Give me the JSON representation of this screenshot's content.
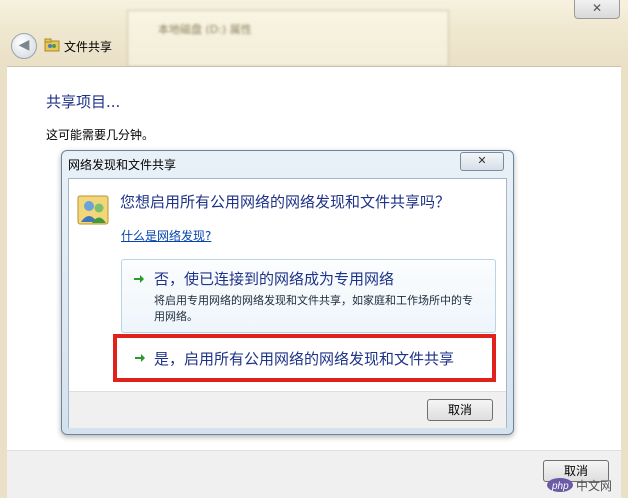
{
  "window": {
    "title": "文件共享",
    "close_icon": "close-icon",
    "back_icon": "back-arrow-icon"
  },
  "background_window": {
    "title": "本地磁盘 (D:) 属性"
  },
  "main": {
    "heading": "共享项目...",
    "wait_text": "这可能需要几分钟。",
    "cancel_label": "取消"
  },
  "dialog": {
    "title": "网络发现和文件共享",
    "question": "您想启用所有公用网络的网络发现和文件共享吗？",
    "help_link": "什么是网络发现?",
    "option_no": {
      "title": "否，使已连接到的网络成为专用网络",
      "description": "将启用专用网络的网络发现和文件共享，如家庭和工作场所中的专用网络。"
    },
    "option_yes": {
      "title": "是，启用所有公用网络的网络发现和文件共享"
    },
    "cancel_label": "取消"
  },
  "watermark": "php中文网",
  "colors": {
    "heading_blue": "#1e3287",
    "highlight_red": "#e1211c",
    "arrow_green": "#2a9a2a"
  }
}
